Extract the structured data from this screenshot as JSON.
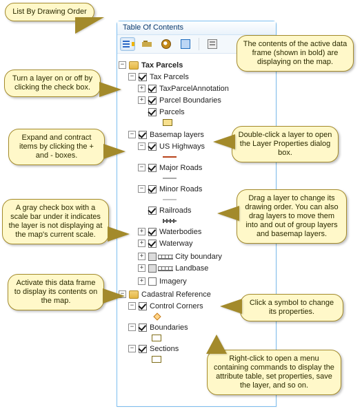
{
  "panel": {
    "title": "Table Of Contents"
  },
  "toolbar": {
    "buttons": [
      {
        "name": "list-by-drawing-order-button",
        "selected": true
      },
      {
        "name": "list-by-source-button",
        "selected": false
      },
      {
        "name": "list-by-visibility-button",
        "selected": false
      },
      {
        "name": "list-by-selection-button",
        "selected": false
      },
      {
        "name": "options-button",
        "selected": false
      }
    ]
  },
  "frames": [
    {
      "name": "Tax Parcels",
      "active": true,
      "expanded": true,
      "layers": [
        {
          "name": "Tax Parcels",
          "type": "group",
          "expanded": true,
          "checked": true,
          "children": [
            {
              "name": "TaxParcelAnnotation",
              "checked": true,
              "expander": "plus"
            },
            {
              "name": "Parcel Boundaries",
              "checked": true,
              "expander": "plus"
            },
            {
              "name": "Parcels",
              "checked": true,
              "expander": "none",
              "symbol": "fill-yellow"
            }
          ]
        },
        {
          "name": "Basemap layers",
          "type": "group",
          "expanded": true,
          "checked": true,
          "children": [
            {
              "name": "US Highways",
              "checked": true,
              "expander": "minus",
              "symbol": "line-orange"
            },
            {
              "name": "Major Roads",
              "checked": true,
              "expander": "minus",
              "symbol": "line-gray"
            },
            {
              "name": "Minor Roads",
              "checked": true,
              "expander": "minus",
              "symbol": "line-lightgray"
            },
            {
              "name": "Railroads",
              "checked": true,
              "expander": "none",
              "symbol": "rail"
            },
            {
              "name": "Waterbodies",
              "checked": true,
              "expander": "plus"
            },
            {
              "name": "Waterway",
              "checked": true,
              "expander": "plus"
            },
            {
              "name": "City boundary",
              "checked": false,
              "grayed": true,
              "expander": "plus",
              "scalebar": true
            },
            {
              "name": "Landbase",
              "checked": false,
              "grayed": true,
              "expander": "plus",
              "scalebar": true
            },
            {
              "name": "Imagery",
              "checked": false,
              "expander": "plus"
            }
          ]
        }
      ]
    },
    {
      "name": "Cadastral Reference",
      "active": false,
      "expanded": true,
      "layers": [
        {
          "name": "Control Corners",
          "checked": true,
          "expander": "minus",
          "symbol": "point"
        },
        {
          "name": "Boundaries",
          "checked": true,
          "expander": "minus",
          "symbol": "fill-outline"
        },
        {
          "name": "Sections",
          "checked": true,
          "expander": "minus",
          "symbol": "fill-outline"
        }
      ]
    }
  ],
  "callouts": {
    "c1": "List By Drawing Order",
    "c2": "The contents of the active data frame (shown in bold) are displaying on the map.",
    "c3": "Turn a layer on or off by clicking the check box.",
    "c4": "Double-click a layer to open the Layer Properties dialog box.",
    "c5": "Expand and contract items by clicking the + and - boxes.",
    "c6": "Drag a layer to change its drawing order. You can also drag layers to move them into and out of group layers and basemap layers.",
    "c7": "A gray check box with a scale bar under it indicates the layer is not displaying at the map's current scale.",
    "c8": "Activate this data frame to display its contents on the map.",
    "c9": "Click a symbol to change its properties.",
    "c10": "Right-click to open a menu containing commands to display the attribute table, set properties, save the layer, and so on."
  }
}
